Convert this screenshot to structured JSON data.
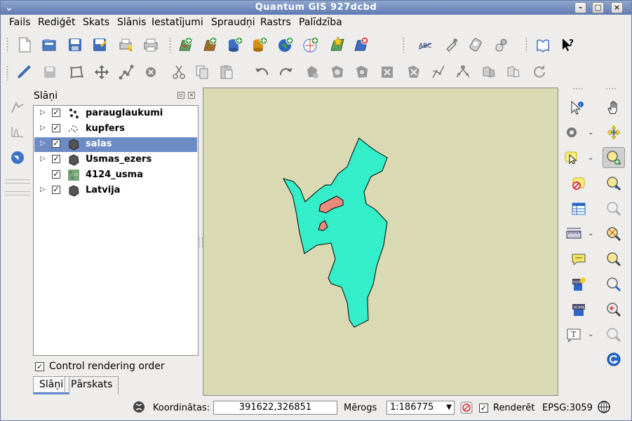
{
  "window": {
    "title": "Quantum GIS 927dcbd",
    "menu_glyph": "⌄",
    "minimize_glyph": "–",
    "maximize_glyph": "□",
    "close_glyph": "×"
  },
  "menubar": {
    "items": [
      "Fails",
      "Rediģēt",
      "Skats",
      "Slānis",
      "Iestatījumi",
      "Spraudņi",
      "Rastrs",
      "Palīdzība"
    ]
  },
  "toolbar_file": {
    "icons": [
      "new-project-icon",
      "open-project-icon",
      "save-project-icon",
      "save-as-icon",
      "print-composer-icon",
      "print-icon",
      "add-vector-layer-icon",
      "add-raster-layer-icon",
      "add-postgis-layer-icon",
      "add-spatialite-layer-icon",
      "add-wms-layer-icon",
      "add-wfs-layer-icon",
      "new-vector-layer-icon",
      "remove-layer-icon",
      "label-icon",
      "plugin-tool-icon",
      "gps-icon",
      "settings-icon",
      "help-contents-icon",
      "whats-this-icon"
    ]
  },
  "toolbar_edit": {
    "icons": [
      "toggle-editing-icon",
      "save-edits-icon",
      "capture-polygon-icon",
      "move-feature-icon",
      "node-tool-icon",
      "delete-selected-icon",
      "cut-features-icon",
      "copy-features-icon",
      "paste-features-icon",
      "undo-icon",
      "redo-icon",
      "simplify-feature-icon",
      "add-ring-icon",
      "add-island-icon",
      "delete-ring-icon",
      "delete-part-icon",
      "reshape-icon",
      "split-features-icon",
      "merge-features-icon",
      "merge-attributes-icon",
      "rotate-point-icon"
    ]
  },
  "layer_panel": {
    "title": "Slāņi",
    "float_glyph": "▫",
    "close_glyph": "×",
    "layers": [
      {
        "name": "parauglaukumi",
        "icon": "point-layer-icon",
        "checked": true,
        "expandable": true,
        "selected": false
      },
      {
        "name": "kupfers",
        "icon": "point-layer-icon",
        "checked": true,
        "expandable": true,
        "selected": false
      },
      {
        "name": "salas",
        "icon": "polygon-layer-icon",
        "checked": true,
        "expandable": true,
        "selected": true
      },
      {
        "name": "Usmas_ezers",
        "icon": "polygon-layer-icon",
        "checked": true,
        "expandable": true,
        "selected": false
      },
      {
        "name": "4124_usma",
        "icon": "raster-layer-icon",
        "checked": true,
        "expandable": false,
        "selected": false
      },
      {
        "name": "Latvija",
        "icon": "polygon-layer-icon",
        "checked": true,
        "expandable": true,
        "selected": false
      }
    ],
    "expand_glyph": "▷",
    "check_glyph": "✓",
    "control_rendering_order_label": "Control rendering order",
    "control_rendering_order_checked": true,
    "tabs": [
      "Slāņi",
      "Pārskats"
    ],
    "active_tab": "Slāņi"
  },
  "map": {
    "background_color": "#d9d9b3",
    "lake_fill": "#33eec8",
    "island_fill": "#e88b7d"
  },
  "right_toolbar": {
    "icons": [
      "identify-icon",
      "pan-icon",
      "zoom-in-icon",
      "zoom-out-icon",
      "select-icon",
      "zoom-full-icon",
      "deselect-icon",
      "zoom-to-selection-icon",
      "open-table-icon",
      "zoom-to-layer-icon",
      "measure-icon",
      "zoom-last-icon",
      "annotation-icon",
      "zoom-next-icon",
      "new-bookmark-icon",
      "refresh-icon",
      "show-bookmarks-icon",
      "text-annotation-icon",
      "map-tips-icon"
    ]
  },
  "statusbar": {
    "coordinates_label": "Koordinātas:",
    "coordinates_value": "391622,326851",
    "scale_label": "Mērogs",
    "scale_value": "1:186775",
    "render_label": "Renderēt",
    "render_checked": true,
    "crs_label": "EPSG:3059"
  }
}
